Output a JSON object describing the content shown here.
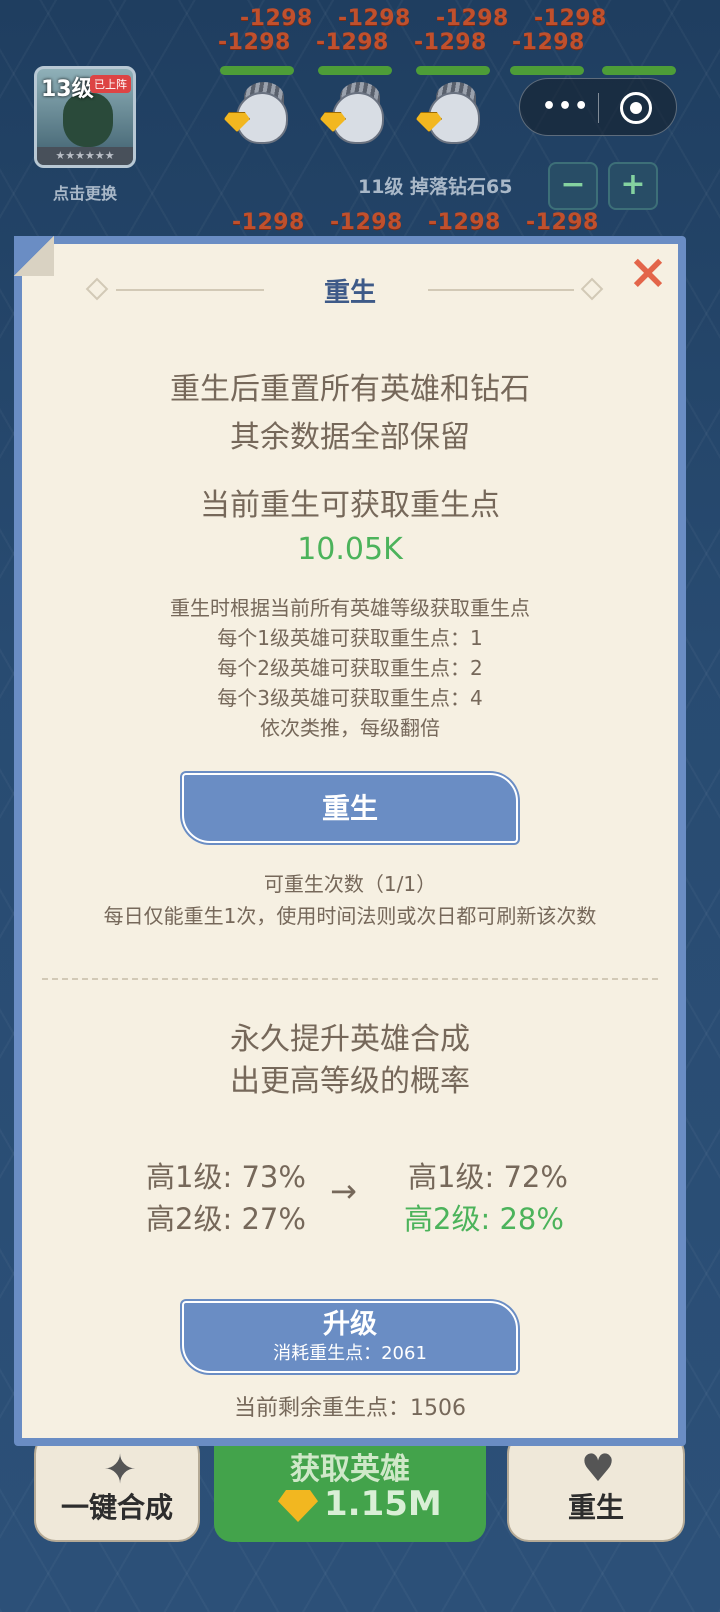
{
  "background": {
    "damage_text": "-1298",
    "hero": {
      "level": "13级",
      "status_tag": "已上阵",
      "stars": "★★★★★★",
      "swap_label": "点击更换"
    },
    "drop_info": "11级 掉落钻石65",
    "minus_label": "−",
    "plus_label": "+"
  },
  "bottom_bar": {
    "merge_label": "一键合成",
    "get_hero_label": "获取英雄",
    "get_hero_cost": "1.15M",
    "rebirth_label": "重生"
  },
  "modal": {
    "title": "重生",
    "close_icon": "×",
    "intro_line1": "重生后重置所有英雄和钻石",
    "intro_line2": "其余数据全部保留",
    "points_heading": "当前重生可获取重生点",
    "points_value": "10.05K",
    "rule_line1": "重生时根据当前所有英雄等级获取重生点",
    "rule_line2": "每个1级英雄可获取重生点：1",
    "rule_line3": "每个2级英雄可获取重生点：2",
    "rule_line4": "每个3级英雄可获取重生点：4",
    "rule_line5": "依次类推，每级翻倍",
    "rebirth_button": "重生",
    "rebirth_count": "可重生次数（1/1）",
    "rebirth_note": "每日仅能重生1次，使用时间法则或次日都可刷新该次数",
    "upgrade_heading_line1": "永久提升英雄合成",
    "upgrade_heading_line2": "出更高等级的概率",
    "current_prob_1": "高1级: 73%",
    "current_prob_2": "高2级: 27%",
    "next_prob_1": "高1级: 72%",
    "next_prob_2": "高2级: 28%",
    "arrow": "→",
    "upgrade_button": "升级",
    "upgrade_cost": "消耗重生点：2061",
    "remaining_points": "当前剩余重生点：1506"
  },
  "colors": {
    "accent_blue": "#6a8dc4",
    "panel_bg": "#f6f0e2",
    "text_brown": "#76685a",
    "highlight_green": "#4cb35b",
    "close_red": "#e3654a"
  },
  "icons": {
    "close": "close-icon",
    "more": "more-dots-icon",
    "target": "target-icon",
    "gem": "diamond-icon",
    "merge": "sparkle-icon",
    "rebirth": "hands-heart-icon"
  }
}
